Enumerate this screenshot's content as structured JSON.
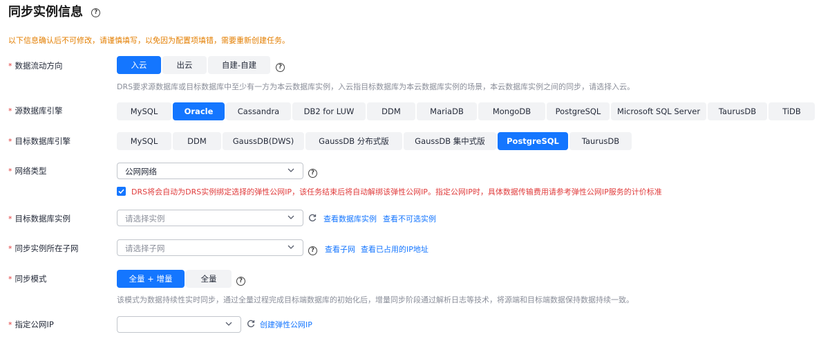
{
  "header": {
    "title": "同步实例信息"
  },
  "notice": "以下信息确认后不可修改，请谨慎填写，以免因为配置项填错，需要重新创建任务。",
  "rows": {
    "flow_direction": {
      "label": "数据流动方向",
      "options": [
        "入云",
        "出云",
        "自建-自建"
      ],
      "selected": "入云",
      "hint": "DRS要求源数据库或目标数据库中至少有一方为本云数据库实例，入云指目标数据库为本云数据库实例的场景，本云数据库实例之间的同步，请选择入云。"
    },
    "source_engine": {
      "label": "源数据库引擎",
      "options": [
        "MySQL",
        "Oracle",
        "Cassandra",
        "DB2 for LUW",
        "DDM",
        "MariaDB",
        "MongoDB",
        "PostgreSQL",
        "Microsoft SQL Server",
        "TaurusDB",
        "TiDB"
      ],
      "selected": "Oracle"
    },
    "target_engine": {
      "label": "目标数据库引擎",
      "options": [
        "MySQL",
        "DDM",
        "GaussDB(DWS)",
        "GaussDB 分布式版",
        "GaussDB 集中式版",
        "PostgreSQL",
        "TaurusDB"
      ],
      "selected": "PostgreSQL"
    },
    "network_type": {
      "label": "网络类型",
      "value": "公网网络",
      "checkbox_text": "DRS将会自动为DRS实例绑定选择的弹性公网IP，该任务结束后将自动解绑该弹性公网IP。指定公网IP时，具体数据传输费用请参考弹性公网IP服务的计价标准",
      "checked": true
    },
    "target_instance": {
      "label": "目标数据库实例",
      "placeholder": "请选择实例",
      "links": [
        "查看数据库实例",
        "查看不可选实例"
      ]
    },
    "subnet": {
      "label": "同步实例所在子网",
      "placeholder": "请选择子网",
      "links": [
        "查看子网",
        "查看已占用的IP地址"
      ]
    },
    "sync_mode": {
      "label": "同步模式",
      "options": [
        "全量 + 增量",
        "全量"
      ],
      "selected": "全量 + 增量",
      "hint": "该模式为数据持续性实时同步，通过全量过程完成目标端数据库的初始化后，增量同步阶段通过解析日志等技术，将源端和目标端数据保持数据持续一致。"
    },
    "public_ip": {
      "label": "指定公网IP",
      "value": "",
      "link": "创建弹性公网IP"
    }
  },
  "colors": {
    "accent": "#1476ff",
    "warning": "#e37e00",
    "error": "#e03c3c"
  },
  "icons": {
    "help": "question-circle-icon",
    "refresh": "refresh-icon",
    "dropdown": "chevron-down-icon",
    "check": "check-icon"
  }
}
